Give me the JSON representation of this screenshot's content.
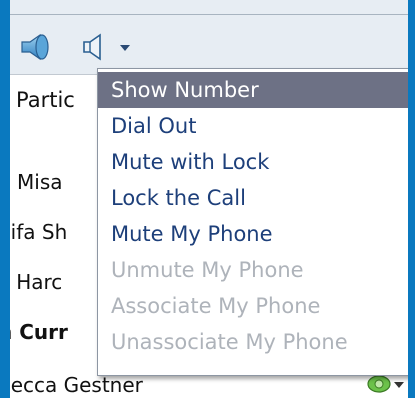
{
  "toolbar": {
    "icons": [
      "speaker-volume-icon",
      "speaker-mute-icon",
      "chevron-down-icon"
    ]
  },
  "header": {
    "column_label": "Partic"
  },
  "participants": [
    {
      "name": "n Misa",
      "bold": false
    },
    {
      "name": "nifa Sh",
      "bold": false
    },
    {
      "name": "y Harc",
      "bold": false
    },
    {
      "name": "n Curr",
      "bold": true
    },
    {
      "name": "becca Gestner",
      "bold": false
    }
  ],
  "menu": {
    "items": [
      {
        "label": "Show Number",
        "state": "selected"
      },
      {
        "label": "Dial Out",
        "state": "enabled"
      },
      {
        "label": "Mute with Lock",
        "state": "enabled"
      },
      {
        "label": "Lock the Call",
        "state": "enabled"
      },
      {
        "label": "Mute My Phone",
        "state": "enabled"
      },
      {
        "label": "Unmute My Phone",
        "state": "disabled"
      },
      {
        "label": "Associate My Phone",
        "state": "disabled"
      },
      {
        "label": "Unassociate My Phone",
        "state": "disabled"
      }
    ]
  },
  "colors": {
    "frame_blue": "#0a79bf",
    "menu_text": "#1d3f7a",
    "menu_selected_bg": "#6d7185",
    "menu_disabled_text": "#aeb3ba"
  }
}
